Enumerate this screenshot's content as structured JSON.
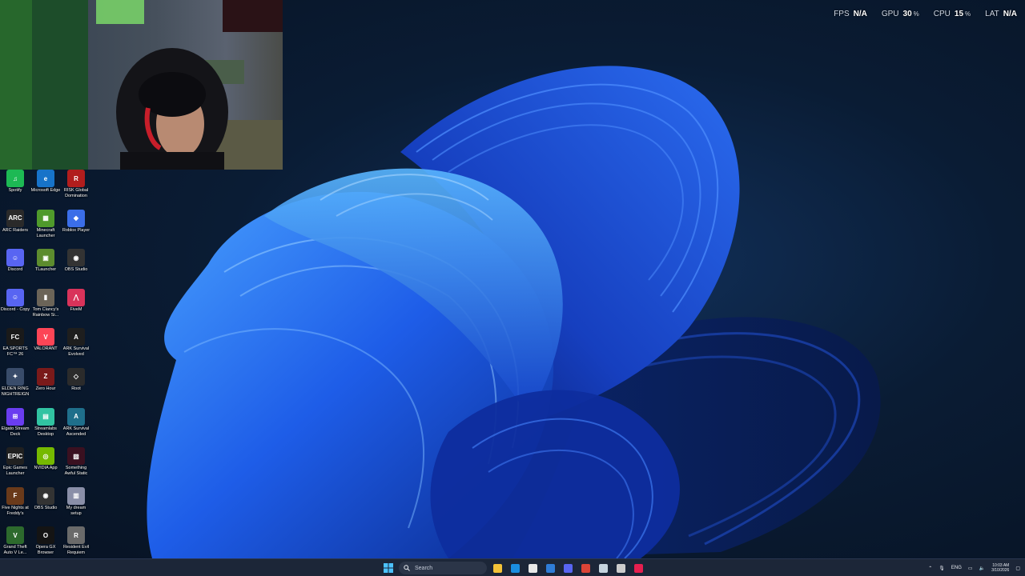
{
  "perf": [
    {
      "label": "FPS",
      "value": "N/A",
      "unit": ""
    },
    {
      "label": "GPU",
      "value": "30",
      "unit": "%"
    },
    {
      "label": "CPU",
      "value": "15",
      "unit": "%"
    },
    {
      "label": "LAT",
      "value": "N/A",
      "unit": ""
    }
  ],
  "desktop_icons": [
    {
      "label": "Spotify",
      "color": "#1db954",
      "glyph": "♫"
    },
    {
      "label": "Microsoft Edge",
      "color": "#1773c9",
      "glyph": "e"
    },
    {
      "label": "RISK Global Domination",
      "color": "#b11d1d",
      "glyph": "R"
    },
    {
      "label": "ARC Raiders",
      "color": "#2a2a2a",
      "glyph": "ARC"
    },
    {
      "label": "Minecraft Launcher",
      "color": "#4f9a2b",
      "glyph": "▦"
    },
    {
      "label": "Roblox Player",
      "color": "#3b6ee8",
      "glyph": "◆"
    },
    {
      "label": "Discord",
      "color": "#5865f2",
      "glyph": "☺"
    },
    {
      "label": "TLauncher",
      "color": "#5d8c2e",
      "glyph": "▣"
    },
    {
      "label": "OBS Studio",
      "color": "#333",
      "glyph": "◉"
    },
    {
      "label": "Discord - Copy",
      "color": "#5865f2",
      "glyph": "☺"
    },
    {
      "label": "Tom Clancy's Rainbow Si...",
      "color": "#6b6458",
      "glyph": "▮"
    },
    {
      "label": "FiveM",
      "color": "#d9335a",
      "glyph": "⋀"
    },
    {
      "label": "EA SPORTS FC™ 26",
      "color": "#1a1a1a",
      "glyph": "FC"
    },
    {
      "label": "VALORANT",
      "color": "#fd4556",
      "glyph": "V"
    },
    {
      "label": "ARK Survival Evolved",
      "color": "#1e1e1e",
      "glyph": "A"
    },
    {
      "label": "ELDEN RING NIGHTREIGN",
      "color": "#394c6a",
      "glyph": "✦"
    },
    {
      "label": "Zero Hour",
      "color": "#7a1a1a",
      "glyph": "Z"
    },
    {
      "label": "Root",
      "color": "#2b2b2b",
      "glyph": "◇"
    },
    {
      "label": "Elgato Stream Deck",
      "color": "#6a3df0",
      "glyph": "⊞"
    },
    {
      "label": "Streamlabs Desktop",
      "color": "#31c3a2",
      "glyph": "▤"
    },
    {
      "label": "ARK Survival Ascended",
      "color": "#1f6f8b",
      "glyph": "A"
    },
    {
      "label": "Epic Games Launcher",
      "color": "#202020",
      "glyph": "EPIC"
    },
    {
      "label": "NVIDIA App",
      "color": "#76b900",
      "glyph": "◎"
    },
    {
      "label": "Something Awful Static",
      "color": "#3a1020",
      "glyph": "▨"
    },
    {
      "label": "Five Nights at Freddy's",
      "color": "#6a3a1a",
      "glyph": "F"
    },
    {
      "label": "OBS Studio",
      "color": "#333",
      "glyph": "◉"
    },
    {
      "label": "My dream setup",
      "color": "#8a8fa8",
      "glyph": "▥"
    },
    {
      "label": "Grand Theft Auto V Le...",
      "color": "#2d6a2d",
      "glyph": "V"
    },
    {
      "label": "Opera GX Browser",
      "color": "#141414",
      "glyph": "O"
    },
    {
      "label": "Resident Evil Requiem",
      "color": "#6a6a6a",
      "glyph": "R"
    }
  ],
  "taskbar": {
    "search_placeholder": "Search",
    "pinned": [
      {
        "name": "file-explorer",
        "color": "#f3c238"
      },
      {
        "name": "edge",
        "color": "#1a8ee0"
      },
      {
        "name": "store",
        "color": "#e8e8e8"
      },
      {
        "name": "mail",
        "color": "#2f7dd8"
      },
      {
        "name": "discord",
        "color": "#5865f2"
      },
      {
        "name": "chrome",
        "color": "#db4437"
      },
      {
        "name": "steam",
        "color": "#c6d4df"
      },
      {
        "name": "obs",
        "color": "#cccccc"
      },
      {
        "name": "opera-gx",
        "color": "#e61f4f"
      }
    ],
    "language": "ENG",
    "time": "10:03 AM",
    "date": "3/10/2026"
  }
}
